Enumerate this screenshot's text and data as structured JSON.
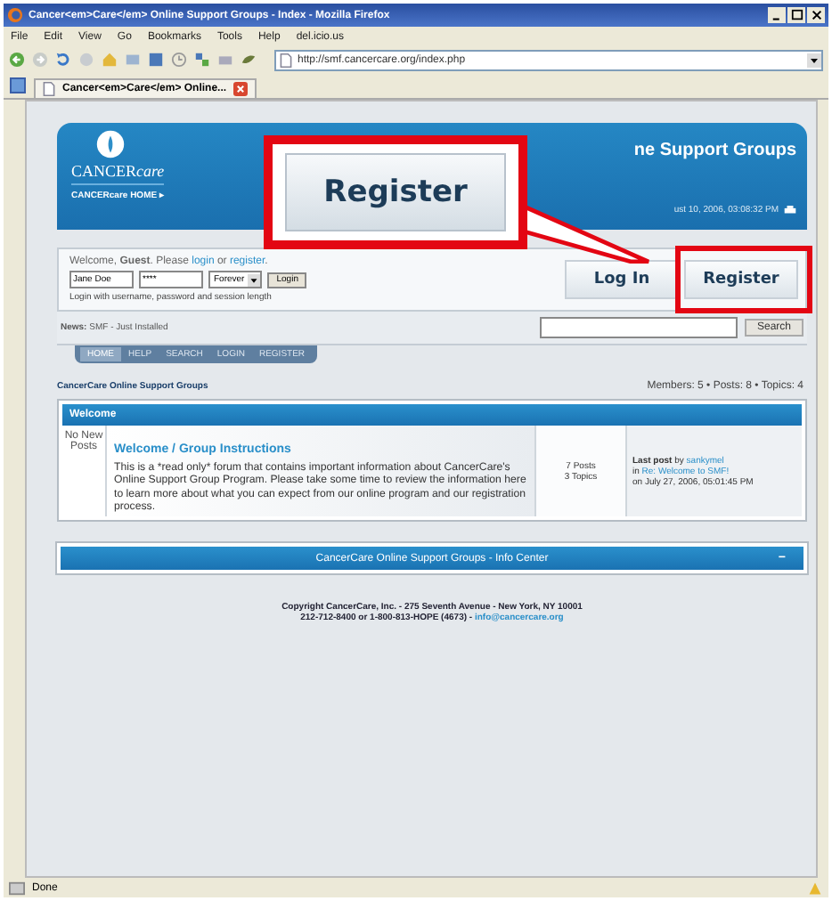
{
  "window": {
    "title": "Cancer<em>Care</em> Online Support Groups - Index - Mozilla Firefox"
  },
  "menu": [
    "File",
    "Edit",
    "View",
    "Go",
    "Bookmarks",
    "Tools",
    "Help",
    "del.icio.us"
  ],
  "address": {
    "value": "http://smf.cancercare.org/index.php"
  },
  "tabs": [
    {
      "label": "Cancer<em>Care</em> Online...",
      "selected": true
    }
  ],
  "header": {
    "logo": {
      "main": "CANCER",
      "accent": "care"
    },
    "home_link": "CANCERcare HOME ▸",
    "title": "ne Support Groups",
    "date": "ust 10, 2006, 03:08:32 PM"
  },
  "callout": {
    "label": "Register"
  },
  "login": {
    "before": "Welcome, **Guest**. Please",
    "login_link": "login",
    "middle": "or",
    "register_link": "register",
    "after": ".",
    "username": "Jane Doe",
    "password": "****",
    "session": "Forever",
    "submit": "Login",
    "hint": "Login with username, password and session length"
  },
  "login_buttons": [
    {
      "label": "Log In",
      "highlighted": false
    },
    {
      "label": "Register",
      "highlighted": true
    }
  ],
  "news": {
    "label": "News:",
    "text": "SMF - Just Installed",
    "search_button": "Search"
  },
  "nav_tabs": [
    {
      "label": "HOME",
      "selected": true
    },
    {
      "label": "HELP",
      "selected": false
    },
    {
      "label": "SEARCH",
      "selected": false
    },
    {
      "label": "LOGIN",
      "selected": false
    },
    {
      "label": "REGISTER",
      "selected": false
    }
  ],
  "breadcrumb": "CancerCare Online Support Groups",
  "stats": "Members: 5 • Posts: 8 • Topics: 4",
  "category": {
    "title": "Welcome",
    "boards": [
      {
        "status": "No New Posts",
        "name": "Welcome / Group Instructions",
        "description": "This is a *read only* forum that contains important information about CancerCare's Online Support Group Program. Please take some time to review the information here to learn more about what you can expect from our online program and our registration process.",
        "posts": "7 Posts",
        "topics": "3 Topics",
        "last_post": {
          "label": "Last post",
          "by": "by",
          "user": "sankymel",
          "in": "in",
          "topic": "Re: Welcome to SMF!",
          "date": "on July 27, 2006, 05:01:45 PM"
        }
      }
    ]
  },
  "info_center": {
    "title": "CancerCare Online Support Groups - Info Center",
    "toggle": "−"
  },
  "footer": {
    "line1": "Copyright CancerCare, Inc. - 275 Seventh Avenue - New York, NY 10001",
    "line2": "212-712-8400 or 1-800-813-HOPE (4673) -",
    "email": "info@cancercare.org"
  },
  "status_bar": {
    "text": "Done"
  }
}
